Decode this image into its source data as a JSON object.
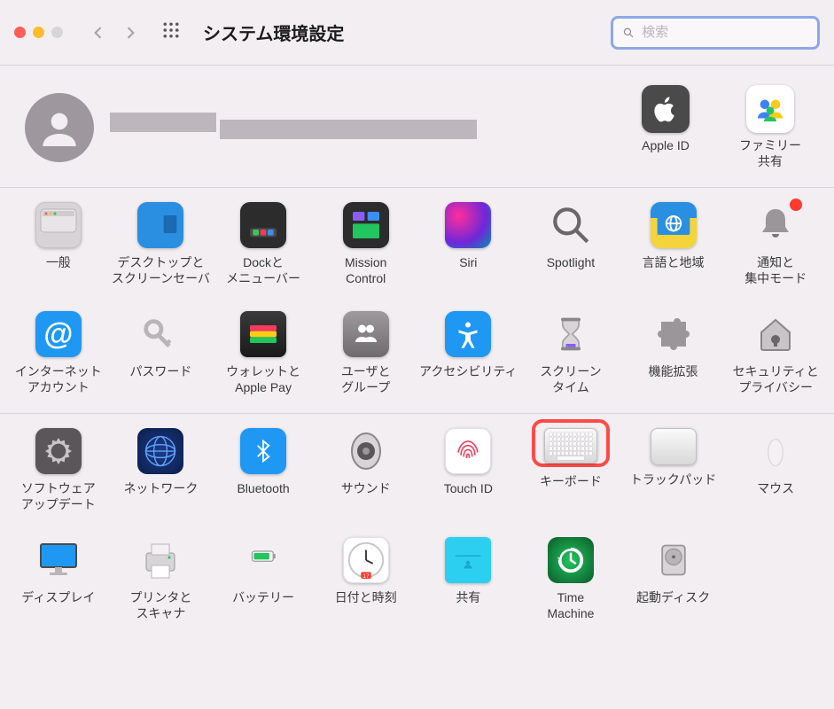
{
  "header": {
    "title": "システム環境設定",
    "search_placeholder": "検索"
  },
  "account": {
    "apple_id_label": "Apple ID",
    "family_label": "ファミリー\n共有"
  },
  "section1": [
    {
      "id": "general",
      "label": "一般"
    },
    {
      "id": "desktop",
      "label": "デスクトップと\nスクリーンセーバ"
    },
    {
      "id": "dock",
      "label": "Dockと\nメニューバー"
    },
    {
      "id": "mission",
      "label": "Mission\nControl"
    },
    {
      "id": "siri",
      "label": "Siri"
    },
    {
      "id": "spotlight",
      "label": "Spotlight"
    },
    {
      "id": "language",
      "label": "言語と地域"
    },
    {
      "id": "notifications",
      "label": "通知と\n集中モード"
    },
    {
      "id": "internet",
      "label": "インターネット\nアカウント"
    },
    {
      "id": "passwords",
      "label": "パスワード"
    },
    {
      "id": "wallet",
      "label": "ウォレットと\nApple Pay"
    },
    {
      "id": "users",
      "label": "ユーザと\nグループ"
    },
    {
      "id": "accessibility",
      "label": "アクセシビリティ"
    },
    {
      "id": "screentime",
      "label": "スクリーン\nタイム"
    },
    {
      "id": "extensions",
      "label": "機能拡張"
    },
    {
      "id": "security",
      "label": "セキュリティと\nプライバシー"
    }
  ],
  "section2": [
    {
      "id": "update",
      "label": "ソフトウェア\nアップデート"
    },
    {
      "id": "network",
      "label": "ネットワーク"
    },
    {
      "id": "bluetooth",
      "label": "Bluetooth"
    },
    {
      "id": "sound",
      "label": "サウンド"
    },
    {
      "id": "touchid",
      "label": "Touch ID"
    },
    {
      "id": "keyboard",
      "label": "キーボード",
      "highlight": true
    },
    {
      "id": "trackpad",
      "label": "トラックパッド"
    },
    {
      "id": "mouse",
      "label": "マウス"
    },
    {
      "id": "display",
      "label": "ディスプレイ"
    },
    {
      "id": "printers",
      "label": "プリンタと\nスキャナ"
    },
    {
      "id": "battery",
      "label": "バッテリー"
    },
    {
      "id": "datetime",
      "label": "日付と時刻"
    },
    {
      "id": "sharing",
      "label": "共有"
    },
    {
      "id": "timemachine",
      "label": "Time\nMachine"
    },
    {
      "id": "startup",
      "label": "起動ディスク"
    }
  ]
}
